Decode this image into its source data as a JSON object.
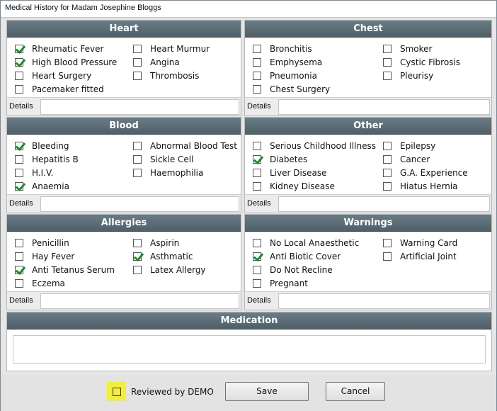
{
  "window": {
    "title": "Medical History for Madam Josephine Bloggs"
  },
  "sections": {
    "heart": {
      "title": "Heart",
      "left": [
        {
          "label": "Rheumatic Fever",
          "checked": true
        },
        {
          "label": "High Blood Pressure",
          "checked": true
        },
        {
          "label": "Heart Surgery",
          "checked": false
        },
        {
          "label": "Pacemaker fitted",
          "checked": false
        }
      ],
      "right": [
        {
          "label": "Heart Murmur",
          "checked": false
        },
        {
          "label": "Angina",
          "checked": false
        },
        {
          "label": "Thrombosis",
          "checked": false
        }
      ],
      "details_label": "Details",
      "details_value": ""
    },
    "chest": {
      "title": "Chest",
      "left": [
        {
          "label": "Bronchitis",
          "checked": false
        },
        {
          "label": "Emphysema",
          "checked": false
        },
        {
          "label": "Pneumonia",
          "checked": false
        },
        {
          "label": "Chest Surgery",
          "checked": false
        }
      ],
      "right": [
        {
          "label": "Smoker",
          "checked": false
        },
        {
          "label": "Cystic Fibrosis",
          "checked": false
        },
        {
          "label": "Pleurisy",
          "checked": false
        }
      ],
      "details_label": "Details",
      "details_value": ""
    },
    "blood": {
      "title": "Blood",
      "left": [
        {
          "label": "Bleeding",
          "checked": true
        },
        {
          "label": "Hepatitis B",
          "checked": false
        },
        {
          "label": "H.I.V.",
          "checked": false
        },
        {
          "label": "Anaemia",
          "checked": true
        }
      ],
      "right": [
        {
          "label": "Abnormal Blood Test",
          "checked": false
        },
        {
          "label": "Sickle Cell",
          "checked": false
        },
        {
          "label": "Haemophilia",
          "checked": false
        }
      ],
      "details_label": "Details",
      "details_value": ""
    },
    "other": {
      "title": "Other",
      "left": [
        {
          "label": "Serious Childhood Illness",
          "checked": false
        },
        {
          "label": "Diabetes",
          "checked": true
        },
        {
          "label": "Liver Disease",
          "checked": false
        },
        {
          "label": "Kidney Disease",
          "checked": false
        }
      ],
      "right": [
        {
          "label": "Epilepsy",
          "checked": false
        },
        {
          "label": "Cancer",
          "checked": false
        },
        {
          "label": "G.A. Experience",
          "checked": false
        },
        {
          "label": "Hiatus Hernia",
          "checked": false
        }
      ],
      "details_label": "Details",
      "details_value": ""
    },
    "allergies": {
      "title": "Allergies",
      "left": [
        {
          "label": "Penicillin",
          "checked": false
        },
        {
          "label": "Hay Fever",
          "checked": false
        },
        {
          "label": "Anti Tetanus Serum",
          "checked": true
        },
        {
          "label": "Eczema",
          "checked": false
        }
      ],
      "right": [
        {
          "label": "Aspirin",
          "checked": false
        },
        {
          "label": "Asthmatic",
          "checked": true
        },
        {
          "label": "Latex Allergy",
          "checked": false
        }
      ],
      "details_label": "Details",
      "details_value": ""
    },
    "warnings": {
      "title": "Warnings",
      "left": [
        {
          "label": "No Local Anaesthetic",
          "checked": false
        },
        {
          "label": "Anti Biotic Cover",
          "checked": true
        },
        {
          "label": "Do Not Recline",
          "checked": false
        },
        {
          "label": "Pregnant",
          "checked": false
        }
      ],
      "right": [
        {
          "label": "Warning Card",
          "checked": false
        },
        {
          "label": "Artificial Joint",
          "checked": false
        }
      ],
      "details_label": "Details",
      "details_value": ""
    }
  },
  "medication": {
    "title": "Medication",
    "value": ""
  },
  "footer": {
    "reviewed_label": "Reviewed by DEMO",
    "reviewed_checked": false,
    "highlight_color": "#f2ee3a",
    "save_label": "Save",
    "cancel_label": "Cancel"
  }
}
